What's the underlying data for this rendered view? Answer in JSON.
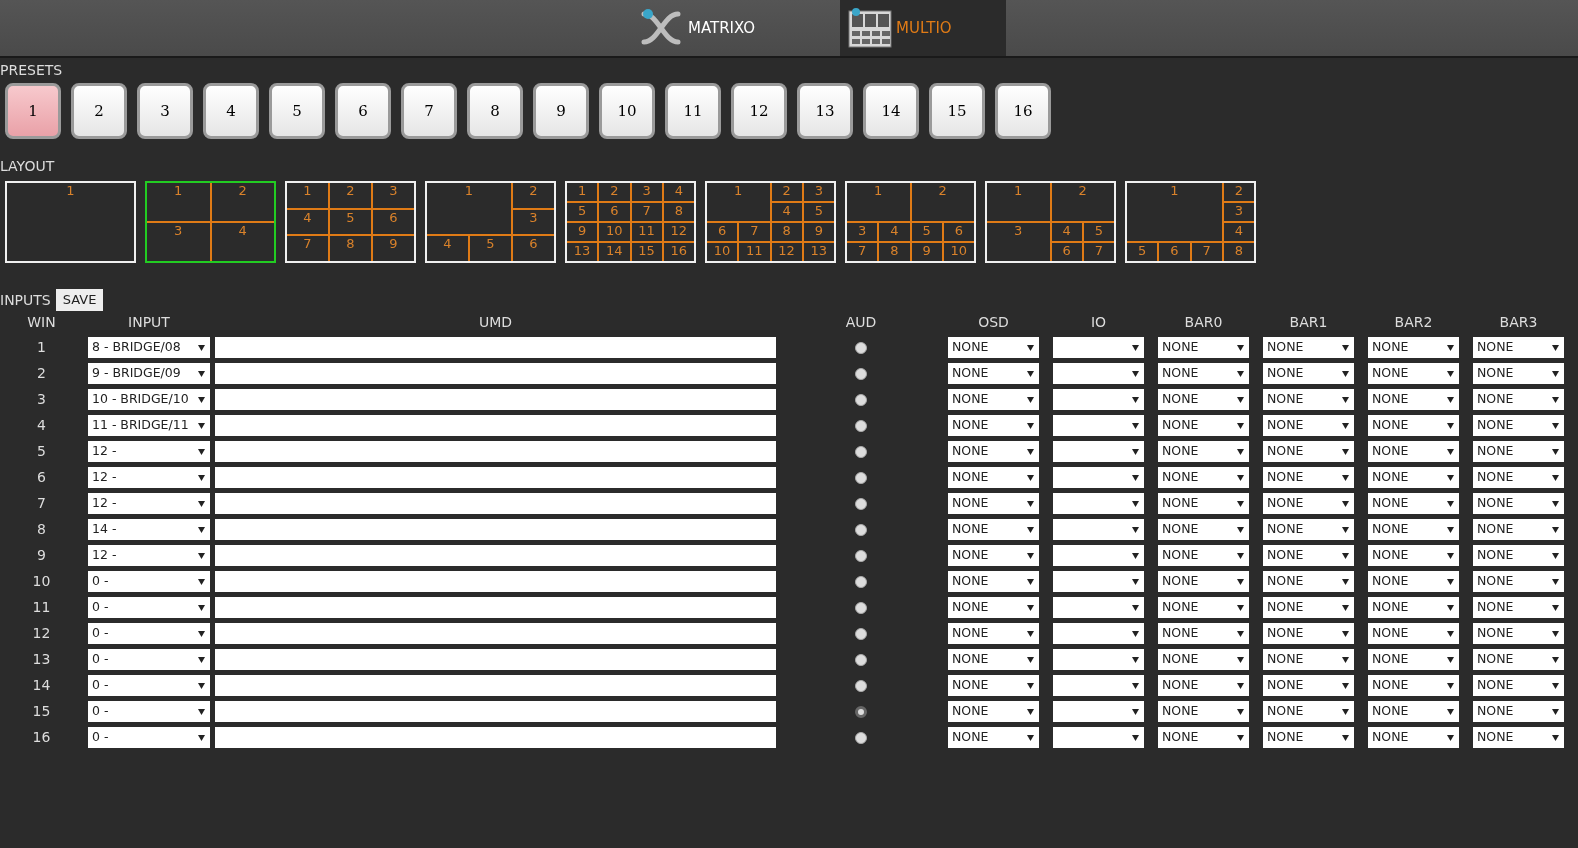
{
  "nav_tabs": [
    {
      "label": "MATRIXO",
      "kind": "matrix",
      "selected": false
    },
    {
      "label": "MULTIO",
      "kind": "multi",
      "selected": true
    }
  ],
  "presets": {
    "title": "PRESETS",
    "items": [
      {
        "label": "1",
        "selected": true
      },
      {
        "label": "2",
        "selected": false
      },
      {
        "label": "3",
        "selected": false
      },
      {
        "label": "4",
        "selected": false
      },
      {
        "label": "5",
        "selected": false
      },
      {
        "label": "6",
        "selected": false
      },
      {
        "label": "7",
        "selected": false
      },
      {
        "label": "8",
        "selected": false
      },
      {
        "label": "9",
        "selected": false
      },
      {
        "label": "10",
        "selected": false
      },
      {
        "label": "11",
        "selected": false
      },
      {
        "label": "12",
        "selected": false
      },
      {
        "label": "13",
        "selected": false
      },
      {
        "label": "14",
        "selected": false
      },
      {
        "label": "15",
        "selected": false
      },
      {
        "label": "16",
        "selected": false
      }
    ]
  },
  "layout": {
    "title": "LAYOUT",
    "items": [
      {
        "selected": false,
        "kind": "single",
        "cells": [
          "1"
        ]
      },
      {
        "selected": true,
        "kind": "quad",
        "cells": [
          "1",
          "2",
          "3",
          "4"
        ]
      },
      {
        "selected": false,
        "kind": "nine",
        "cells": [
          "1",
          "2",
          "3",
          "4",
          "5",
          "6",
          "7",
          "8",
          "9"
        ]
      },
      {
        "selected": false,
        "kind": "six",
        "cells": [
          "1",
          "2",
          "3",
          "4",
          "5",
          "6"
        ]
      },
      {
        "selected": false,
        "kind": "sixteen",
        "cells": [
          "1",
          "2",
          "3",
          "4",
          "5",
          "6",
          "7",
          "8",
          "9",
          "10",
          "11",
          "12",
          "13",
          "14",
          "15",
          "16"
        ]
      },
      {
        "selected": false,
        "kind": "thirteen",
        "cells": [
          "1",
          "2",
          "3",
          "4",
          "5",
          "6",
          "7",
          "8",
          "9",
          "10",
          "11",
          "12",
          "13"
        ]
      },
      {
        "selected": false,
        "kind": "ten",
        "cells": [
          "1",
          "2",
          "3",
          "4",
          "5",
          "6",
          "7",
          "8",
          "9",
          "10"
        ]
      },
      {
        "selected": false,
        "kind": "seven",
        "cells": [
          "1",
          "2",
          "3",
          "4",
          "5",
          "6",
          "7"
        ]
      },
      {
        "selected": false,
        "kind": "eight",
        "cells": [
          "1",
          "2",
          "3",
          "4",
          "5",
          "6",
          "7",
          "8"
        ]
      }
    ]
  },
  "inputs": {
    "title": "INPUTS",
    "save_button": "SAVE",
    "columns": [
      "WIN",
      "INPUT",
      "UMD",
      "AUD",
      "OSD",
      "IO",
      "BAR0",
      "BAR1",
      "BAR2",
      "BAR3"
    ],
    "rows": [
      {
        "win": "1",
        "input": "8 - BRIDGE/08",
        "aud_selected": false,
        "osd": "NONE",
        "bars": [
          "NONE",
          "NONE",
          "NONE",
          "NONE"
        ]
      },
      {
        "win": "2",
        "input": "9 - BRIDGE/09",
        "aud_selected": false,
        "osd": "NONE",
        "bars": [
          "NONE",
          "NONE",
          "NONE",
          "NONE"
        ]
      },
      {
        "win": "3",
        "input": "10 - BRIDGE/10",
        "aud_selected": false,
        "osd": "NONE",
        "bars": [
          "NONE",
          "NONE",
          "NONE",
          "NONE"
        ]
      },
      {
        "win": "4",
        "input": "11 - BRIDGE/11",
        "aud_selected": false,
        "osd": "NONE",
        "bars": [
          "NONE",
          "NONE",
          "NONE",
          "NONE"
        ]
      },
      {
        "win": "5",
        "input": "12 -",
        "aud_selected": false,
        "osd": "NONE",
        "bars": [
          "NONE",
          "NONE",
          "NONE",
          "NONE"
        ]
      },
      {
        "win": "6",
        "input": "12 -",
        "aud_selected": false,
        "osd": "NONE",
        "bars": [
          "NONE",
          "NONE",
          "NONE",
          "NONE"
        ]
      },
      {
        "win": "7",
        "input": "12 -",
        "aud_selected": false,
        "osd": "NONE",
        "bars": [
          "NONE",
          "NONE",
          "NONE",
          "NONE"
        ]
      },
      {
        "win": "8",
        "input": "14 -",
        "aud_selected": false,
        "osd": "NONE",
        "bars": [
          "NONE",
          "NONE",
          "NONE",
          "NONE"
        ]
      },
      {
        "win": "9",
        "input": "12 -",
        "aud_selected": false,
        "osd": "NONE",
        "bars": [
          "NONE",
          "NONE",
          "NONE",
          "NONE"
        ]
      },
      {
        "win": "10",
        "input": "0 -",
        "aud_selected": false,
        "osd": "NONE",
        "bars": [
          "NONE",
          "NONE",
          "NONE",
          "NONE"
        ]
      },
      {
        "win": "11",
        "input": "0 -",
        "aud_selected": false,
        "osd": "NONE",
        "bars": [
          "NONE",
          "NONE",
          "NONE",
          "NONE"
        ]
      },
      {
        "win": "12",
        "input": "0 -",
        "aud_selected": false,
        "osd": "NONE",
        "bars": [
          "NONE",
          "NONE",
          "NONE",
          "NONE"
        ]
      },
      {
        "win": "13",
        "input": "0 -",
        "aud_selected": false,
        "osd": "NONE",
        "bars": [
          "NONE",
          "NONE",
          "NONE",
          "NONE"
        ]
      },
      {
        "win": "14",
        "input": "0 -",
        "aud_selected": false,
        "osd": "NONE",
        "bars": [
          "NONE",
          "NONE",
          "NONE",
          "NONE"
        ]
      },
      {
        "win": "15",
        "input": "0 -",
        "aud_selected": true,
        "osd": "NONE",
        "bars": [
          "NONE",
          "NONE",
          "NONE",
          "NONE"
        ]
      },
      {
        "win": "16",
        "input": "0 -",
        "aud_selected": false,
        "osd": "NONE",
        "bars": [
          "NONE",
          "NONE",
          "NONE",
          "NONE"
        ]
      }
    ]
  }
}
